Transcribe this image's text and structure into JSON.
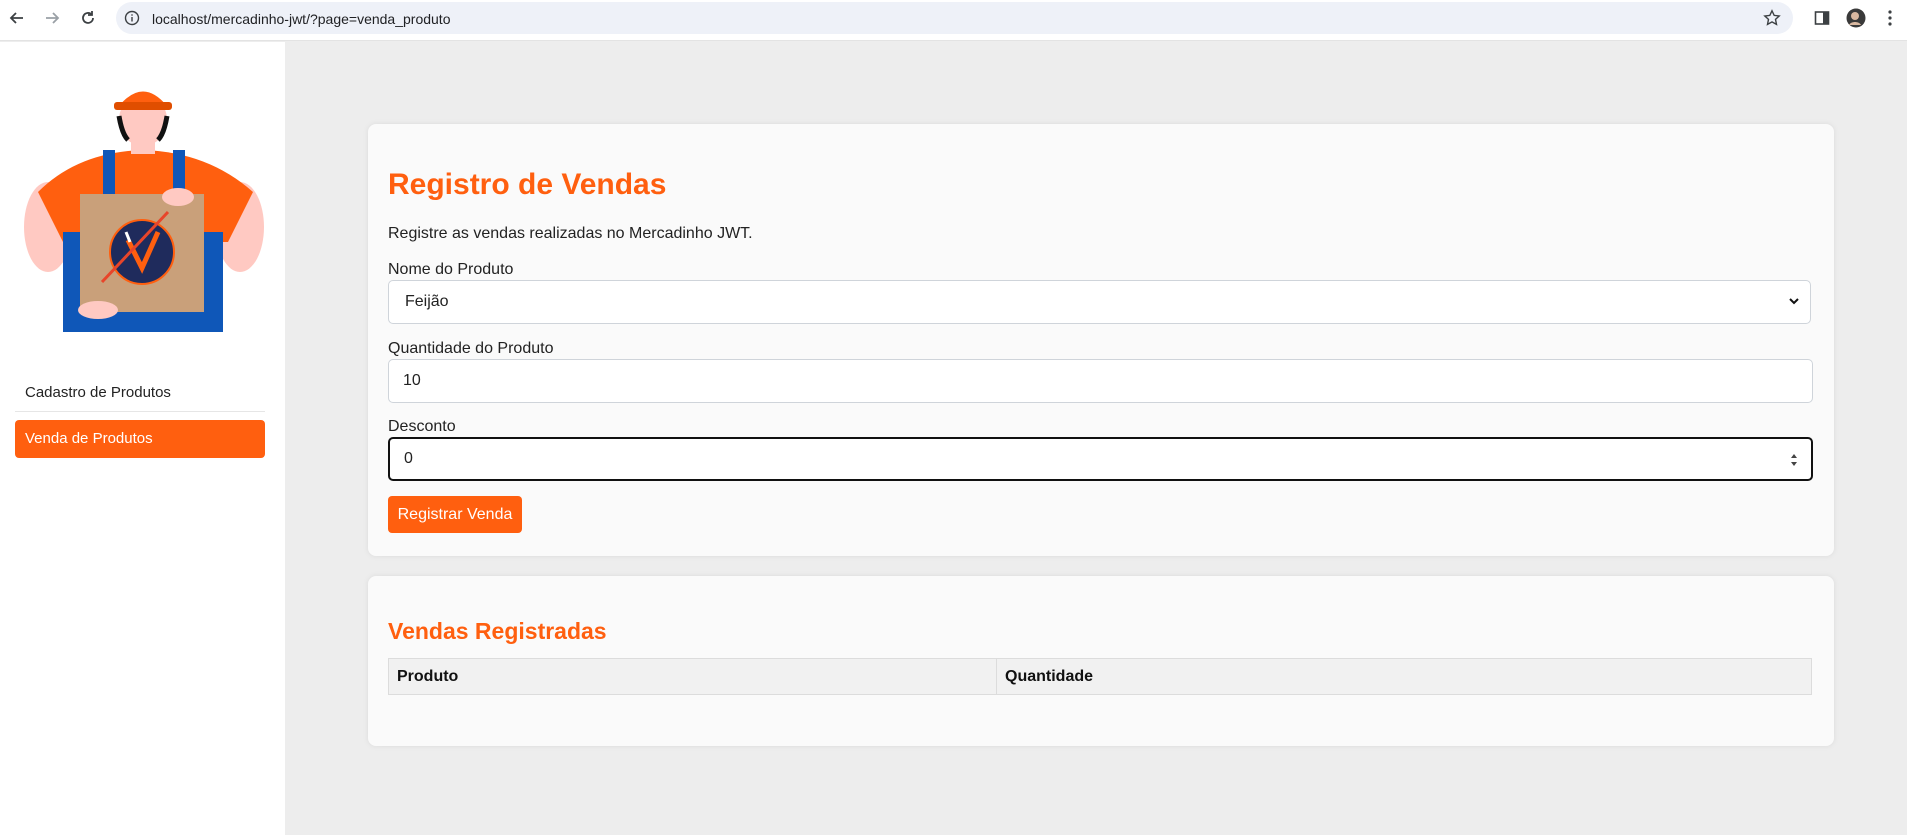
{
  "browser": {
    "url": "localhost/mercadinho-jwt/?page=venda_produto",
    "icons": [
      "back-icon",
      "forward-icon",
      "reload-icon",
      "info-icon",
      "star-icon",
      "sidepanel-icon",
      "profile-avatar",
      "kebab-menu-icon"
    ]
  },
  "sidebar": {
    "items": [
      {
        "label": "Cadastro de Produtos",
        "active": false
      },
      {
        "label": "Venda de Produtos",
        "active": true
      }
    ]
  },
  "sales_form": {
    "title": "Registro de Vendas",
    "description": "Registre as vendas realizadas no Mercadinho JWT.",
    "product_label": "Nome do Produto",
    "product_value": "Feijão",
    "quantity_label": "Quantidade do Produto",
    "quantity_value": "10",
    "discount_label": "Desconto",
    "discount_value": "0",
    "submit_label": "Registrar Venda"
  },
  "sales_list": {
    "title": "Vendas Registradas",
    "columns": [
      "Produto",
      "Quantidade"
    ],
    "rows": []
  },
  "colors": {
    "accent": "#ff5f0f",
    "page_background": "#ededed",
    "card_background": "#fafafa"
  }
}
